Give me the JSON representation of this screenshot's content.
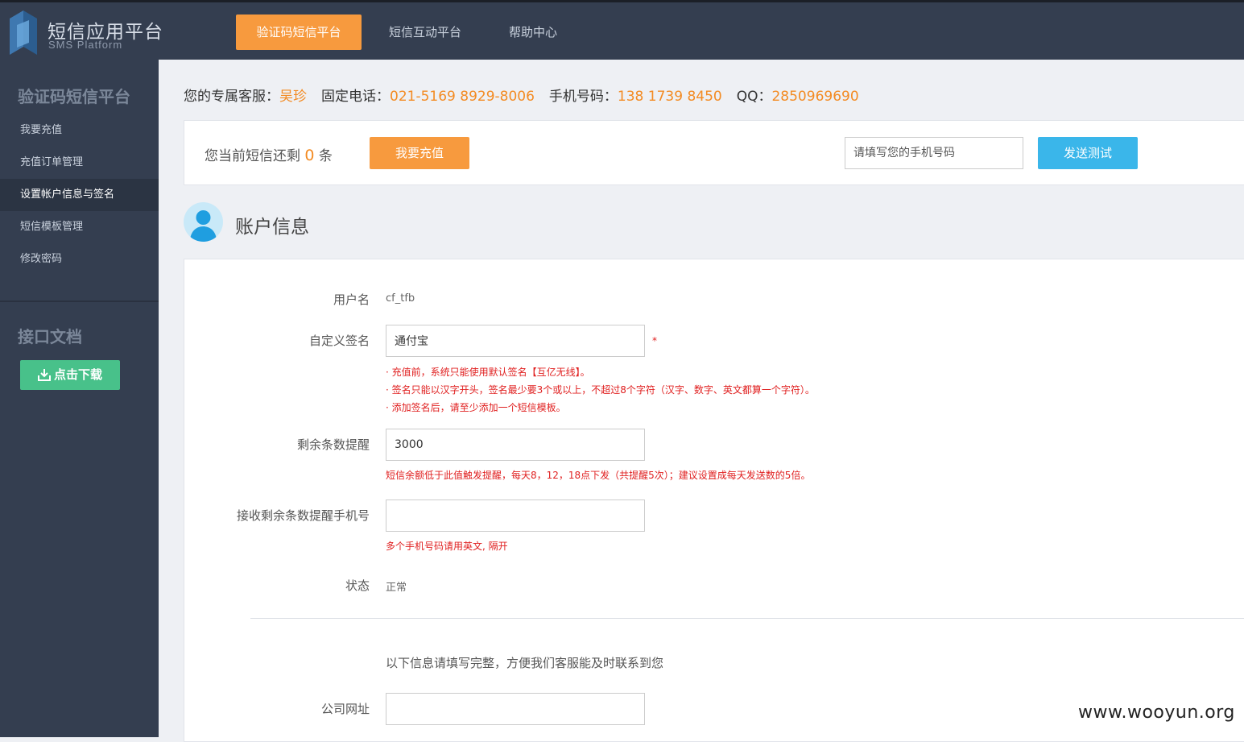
{
  "app": {
    "title": "短信应用平台",
    "subtitle": "SMS Platform"
  },
  "nav": {
    "tabs": [
      {
        "label": "验证码短信平台",
        "active": true
      },
      {
        "label": "短信互动平台",
        "active": false
      },
      {
        "label": "帮助中心",
        "active": false
      }
    ]
  },
  "sidebar": {
    "section1_title": "验证码短信平台",
    "items": [
      {
        "label": "我要充值",
        "active": false
      },
      {
        "label": "充值订单管理",
        "active": false
      },
      {
        "label": "设置帐户信息与签名",
        "active": true
      },
      {
        "label": "短信模板管理",
        "active": false
      },
      {
        "label": "修改密码",
        "active": false
      }
    ],
    "section2_title": "接口文档",
    "download_label": "点击下载"
  },
  "contact": {
    "service_label": "您的专属客服：",
    "service_value": "吴珍",
    "phone_label": "固定电话：",
    "phone_value": "021-5169 8929-8006",
    "mobile_label": "手机号码：",
    "mobile_value": "138 1739 8450",
    "qq_label": "QQ：",
    "qq_value": "2850969690"
  },
  "balance": {
    "prefix": "您当前短信还剩",
    "count": "0",
    "suffix": "条",
    "recharge_label": "我要充值",
    "phone_placeholder": "请填写您的手机号码",
    "send_test_label": "发送测试"
  },
  "account": {
    "title": "账户信息",
    "username_label": "用户名",
    "username_value": "cf_tfb",
    "signature_label": "自定义签名",
    "signature_value": "通付宝",
    "required_mark": "*",
    "signature_hints": [
      "· 充值前，系统只能使用默认签名【互亿无线】。",
      "· 签名只能以汉字开头，签名最少要3个或以上，不超过8个字符（汉字、数字、英文都算一个字符）。",
      "· 添加签名后，请至少添加一个短信模板。"
    ],
    "remain_label": "剩余条数提醒",
    "remain_value": "3000",
    "remain_hint": "短信余额低于此值触发提醒，每天8，12，18点下发（共提醒5次）；建议设置成每天发送数的5倍。",
    "remind_phone_label": "接收剩余条数提醒手机号",
    "remind_phone_value": "",
    "remind_phone_hint": "多个手机号码请用英文, 隔开",
    "status_label": "状态",
    "status_value": "正常",
    "info_note": "以下信息请填写完整，方便我们客服能及时联系到您",
    "website_label": "公司网址",
    "website_value": ""
  },
  "watermark": "www.wooyun.org",
  "colors": {
    "topbar": "#343e50",
    "accent_orange": "#f79a3e",
    "accent_blue": "#3ab6ea",
    "accent_green": "#48c18a",
    "highlight_text": "#f38b23",
    "error_text": "#e02020"
  }
}
